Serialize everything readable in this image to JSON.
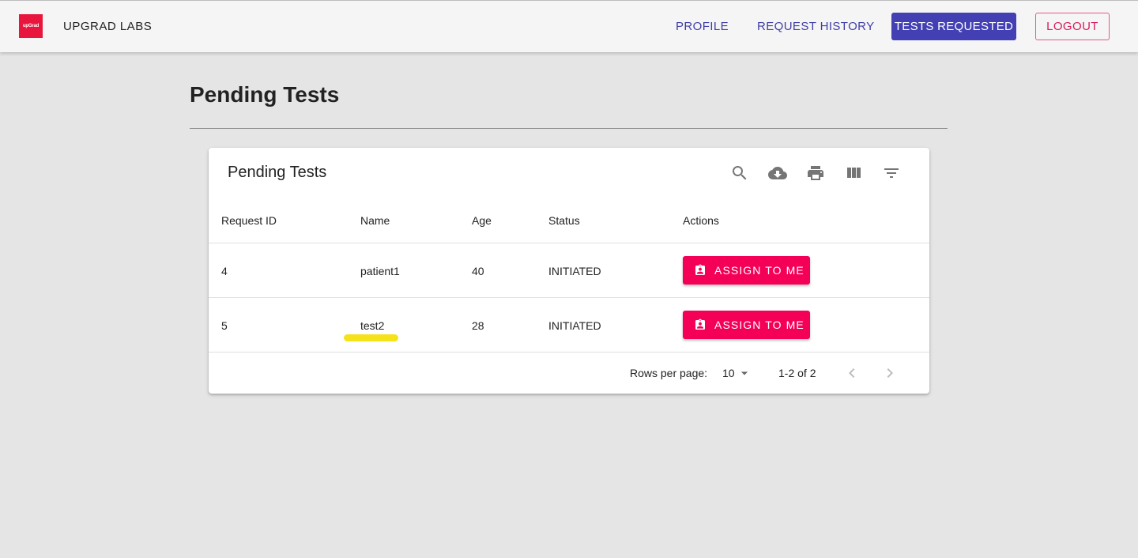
{
  "header": {
    "logo_text": "upGrad",
    "brand": "UPGRAD LABS",
    "nav": {
      "profile": "PROFILE",
      "request_history": "REQUEST HISTORY",
      "tests_requested": "TESTS REQUESTED",
      "logout": "LOGOUT"
    }
  },
  "page": {
    "title": "Pending Tests"
  },
  "table": {
    "title": "Pending Tests",
    "toolbar_icons": [
      "search-icon",
      "cloud-download-icon",
      "print-icon",
      "view-column-icon",
      "filter-list-icon"
    ],
    "columns": [
      "Request ID",
      "Name",
      "Age",
      "Status",
      "Actions"
    ],
    "rows": [
      {
        "request_id": "4",
        "name": "patient1",
        "age": "40",
        "status": "INITIATED",
        "action": "ASSIGN TO ME"
      },
      {
        "request_id": "5",
        "name": "test2",
        "age": "28",
        "status": "INITIATED",
        "action": "ASSIGN TO ME"
      }
    ],
    "footer": {
      "rows_per_page_label": "Rows per page:",
      "rows_per_page_value": "10",
      "range": "1-2 of 2"
    }
  },
  "colors": {
    "primary": "#4240b2",
    "secondary": "#f50057",
    "highlight": "#f5e21a"
  }
}
